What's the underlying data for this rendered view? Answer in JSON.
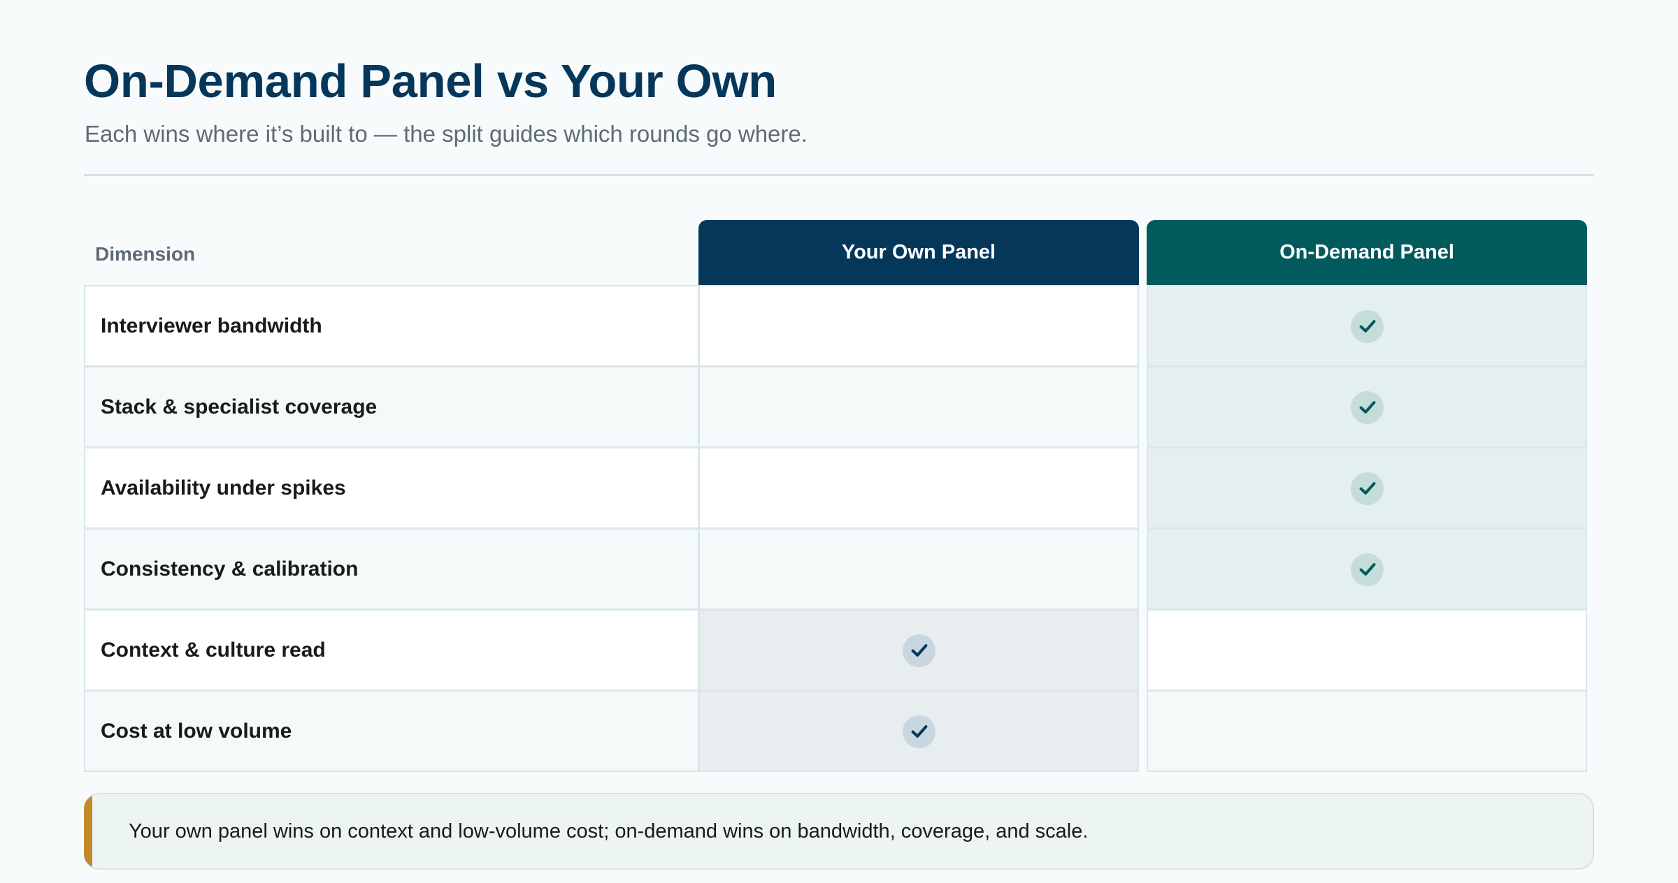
{
  "header": {
    "title": "On-Demand Panel vs Your Own",
    "subtitle": "Each wins where it’s built to — the split guides which rounds go where."
  },
  "table": {
    "dimension_header": "Dimension",
    "columns": [
      {
        "key": "own",
        "label": "Your Own Panel",
        "color": "#05375b"
      },
      {
        "key": "ondemand",
        "label": "On-Demand Panel",
        "color": "#035a5c"
      }
    ],
    "rows": [
      {
        "label": "Interviewer bandwidth",
        "own": false,
        "ondemand": true
      },
      {
        "label": "Stack & specialist coverage",
        "own": false,
        "ondemand": true
      },
      {
        "label": "Availability under spikes",
        "own": false,
        "ondemand": true
      },
      {
        "label": "Consistency & calibration",
        "own": false,
        "ondemand": true
      },
      {
        "label": "Context & culture read",
        "own": true,
        "ondemand": false
      },
      {
        "label": "Cost at low volume",
        "own": true,
        "ondemand": false
      }
    ],
    "win_icon": "check-icon"
  },
  "callout": {
    "text": "Your own panel wins on context and low-volume cost; on-demand wins on bandwidth, coverage, and scale.",
    "accent_color": "#c4892a"
  }
}
